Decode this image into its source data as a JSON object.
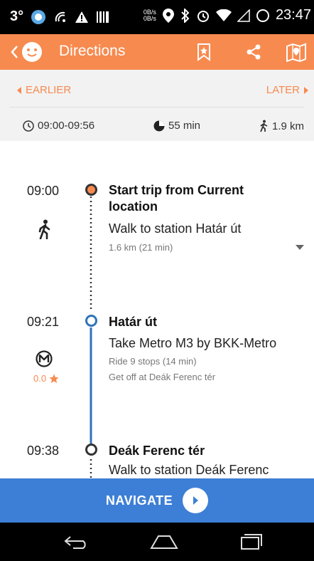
{
  "status_bar": {
    "temperature": "3°",
    "net_up": "0B/s",
    "net_down": "0B/s",
    "clock": "23:47"
  },
  "app_bar": {
    "title": "Directions"
  },
  "time_bar": {
    "earlier_label": "EARLIER",
    "later_label": "LATER",
    "time_range": "09:00-09:56",
    "duration": "55 min",
    "walk_distance": "1.9 km"
  },
  "steps": [
    {
      "time": "09:00",
      "title_line1": "Start trip from Current",
      "title_line2": "location",
      "action": "Walk to station Határ út",
      "detail": "1.6 km (21  min)"
    },
    {
      "time": "09:21",
      "title": "Határ út",
      "action": "Take Metro M3 by BKK-Metro",
      "detail": "Ride 9 stops (14  min)",
      "detail2": "Get off at Deák Ferenc tér",
      "rating": "0.0"
    },
    {
      "time": "09:38",
      "title": "Deák Ferenc tér",
      "action": "Walk to station Deák Ferenc"
    }
  ],
  "navigate": {
    "label": "NAVIGATE"
  },
  "colors": {
    "accent": "#f78a4f",
    "metro_line": "#2f73b8",
    "nav_button": "#3d7fd6"
  }
}
